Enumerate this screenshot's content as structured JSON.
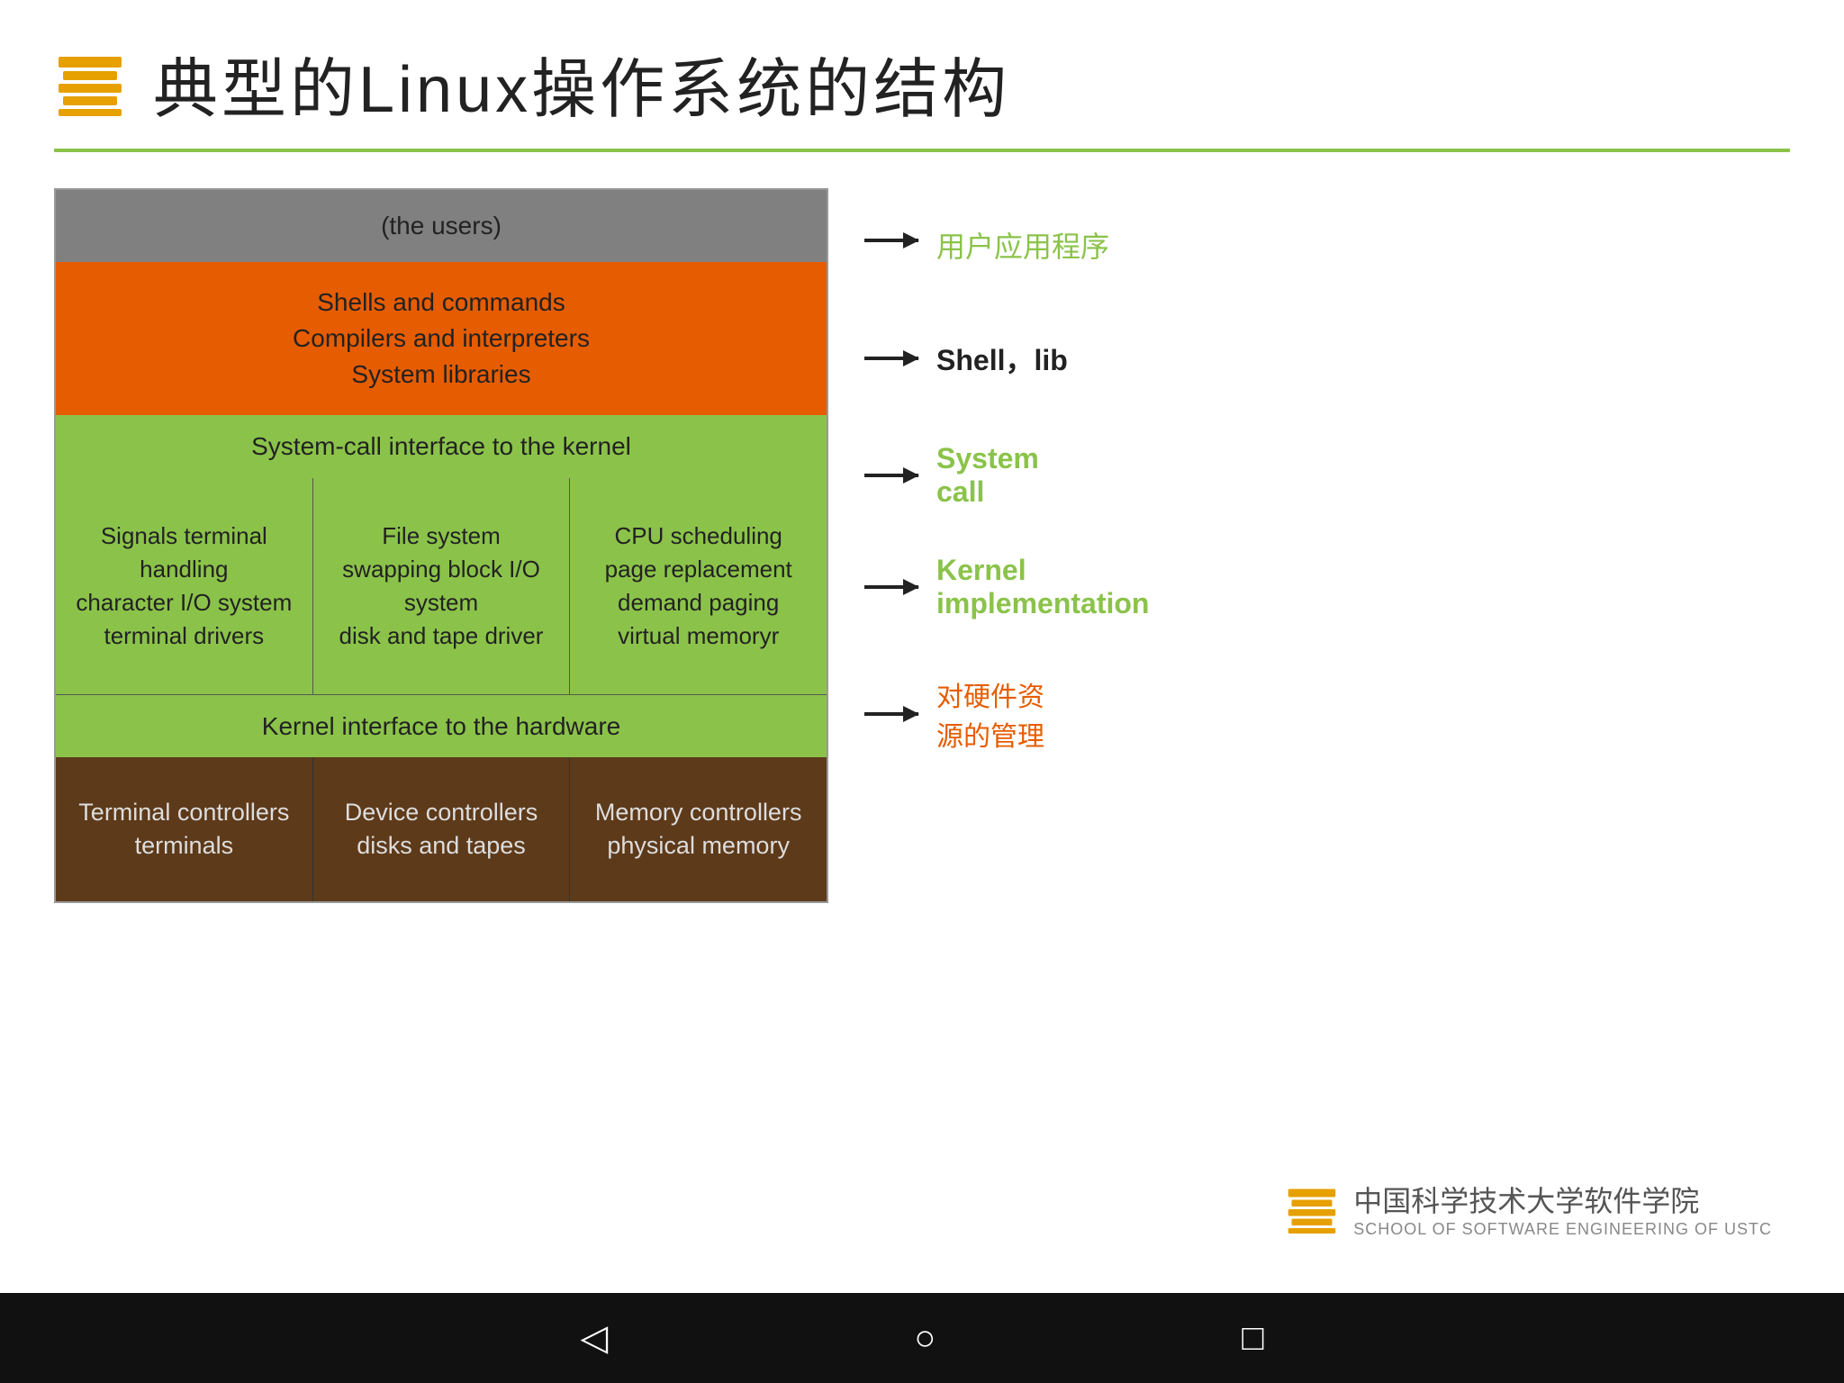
{
  "header": {
    "title": "典型的Linux操作系统的结构"
  },
  "diagram": {
    "users_layer": "(the users)",
    "shell_layer": {
      "line1": "Shells and commands",
      "line2": "Compilers and interpreters",
      "line3": "System libraries"
    },
    "syscall_layer": "System-call interface to the kernel",
    "kernel_cells": [
      {
        "line1": "Signals terminal",
        "line2": "handling",
        "line3": "character I/O system",
        "line4": "terminal    drivers"
      },
      {
        "line1": "File system",
        "line2": "swapping block I/O",
        "line3": "system",
        "line4": "disk and tape driver"
      },
      {
        "line1": "CPU scheduling",
        "line2": "page replacement",
        "line3": "demand paging",
        "line4": "virtual memoryr"
      }
    ],
    "hw_interface": "Kernel interface to the hardware",
    "controllers": [
      {
        "line1": "Terminal controllers",
        "line2": "terminals"
      },
      {
        "line1": "Device controllers",
        "line2": "disks and tapes"
      },
      {
        "line1": "Memory controllers",
        "line2": "physical memory"
      }
    ]
  },
  "annotations": {
    "users": "用户应用程序",
    "shell": "Shell，lib",
    "syscall_line1": "System",
    "syscall_line2": "call",
    "kernel_line1": "Kernel",
    "kernel_line2": "implementation",
    "hardware_line1": "对硬件资",
    "hardware_line2": "源的管理"
  },
  "footer": {
    "main": "中国科学技术大学软件学院",
    "sub": "SCHOOL OF SOFTWARE ENGINEERING OF USTC"
  },
  "navbar": {
    "back": "◁",
    "home": "○",
    "square": "□"
  }
}
